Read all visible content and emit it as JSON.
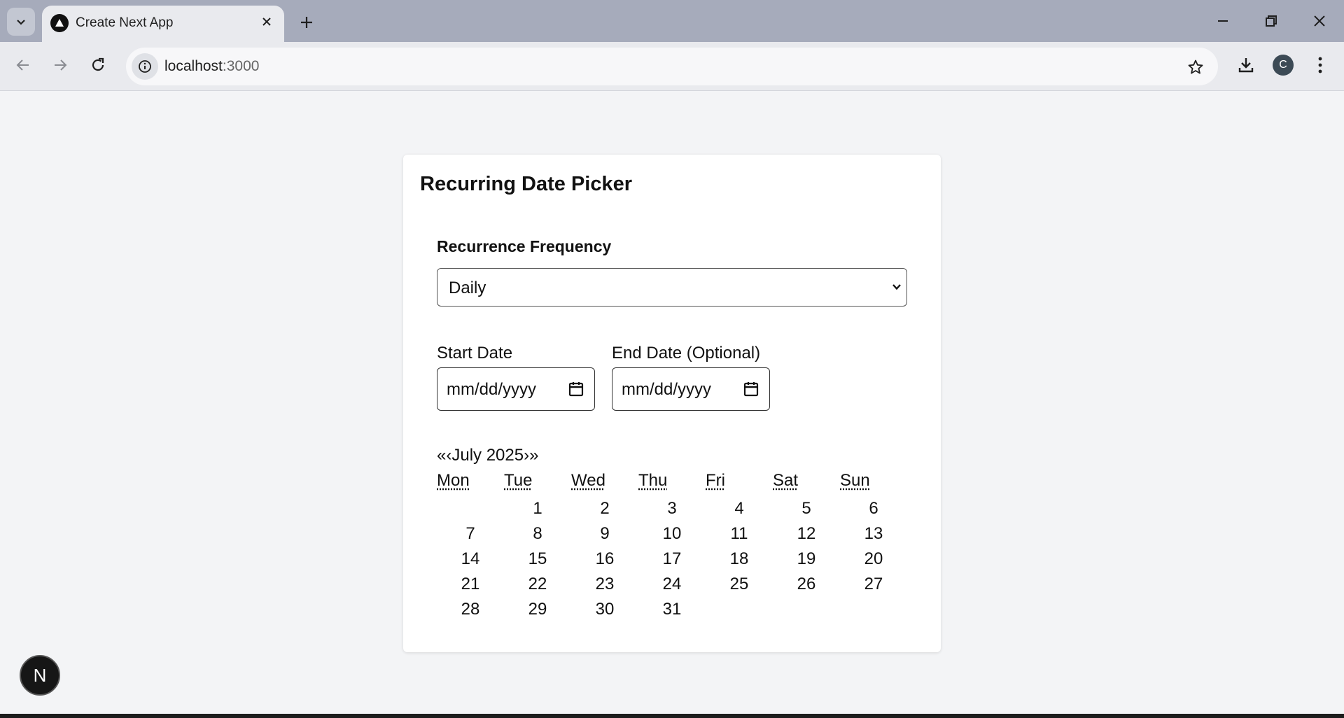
{
  "browser": {
    "tab_title": "Create Next App",
    "url_host": "localhost",
    "url_port": ":3000",
    "profile_initial": "C"
  },
  "page": {
    "title": "Recurring Date Picker",
    "frequency_label": "Recurrence Frequency",
    "frequency_value": "Daily",
    "start_date_label": "Start Date",
    "end_date_label": "End Date (Optional)",
    "date_placeholder": "mm/dd/yyyy"
  },
  "calendar": {
    "prev_year": "«",
    "prev_month": "‹",
    "month_label": "July 2025",
    "next_month": "›",
    "next_year": "»",
    "weekdays": [
      "Mon",
      "Tue",
      "Wed",
      "Thu",
      "Fri",
      "Sat",
      "Sun"
    ],
    "first_weekday_index": 1,
    "days": [
      "1",
      "2",
      "3",
      "4",
      "5",
      "6",
      "7",
      "8",
      "9",
      "10",
      "11",
      "12",
      "13",
      "14",
      "15",
      "16",
      "17",
      "18",
      "19",
      "20",
      "21",
      "22",
      "23",
      "24",
      "25",
      "26",
      "27",
      "28",
      "29",
      "30",
      "31"
    ]
  },
  "next_badge": "N"
}
